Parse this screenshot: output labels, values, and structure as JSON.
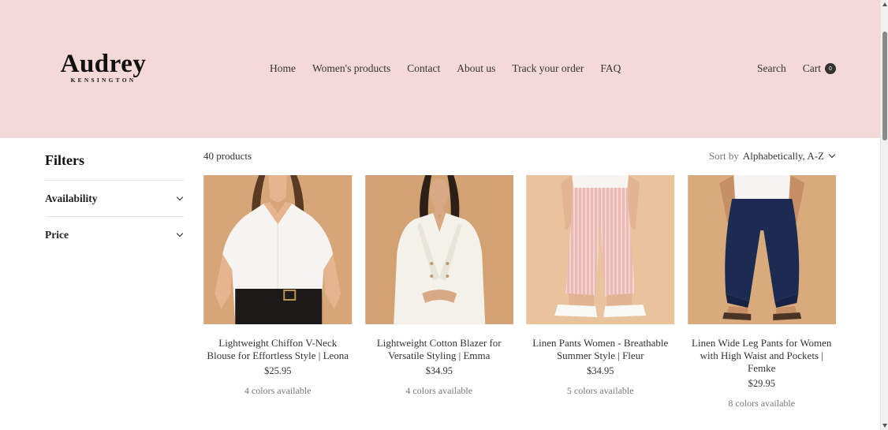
{
  "brand": {
    "name": "Audrey",
    "subtitle": "KENSINGTON"
  },
  "nav": [
    {
      "label": "Home"
    },
    {
      "label": "Women's products"
    },
    {
      "label": "Contact"
    },
    {
      "label": "About us"
    },
    {
      "label": "Track your order"
    },
    {
      "label": "FAQ"
    }
  ],
  "header": {
    "search_label": "Search",
    "cart_label": "Cart",
    "cart_count": "0"
  },
  "filters": {
    "title": "Filters",
    "items": [
      {
        "label": "Availability"
      },
      {
        "label": "Price"
      }
    ]
  },
  "toolbar": {
    "count": "40 products",
    "sort_label": "Sort by",
    "sort_value": "Alphabetically, A-Z"
  },
  "products": [
    {
      "name": "Lightweight Chiffon V-Neck Blouse for Effortless Style | Leona",
      "price": "$25.95",
      "colors": "4 colors available",
      "image": "woman-white-vneck-blouse-photo"
    },
    {
      "name": "Lightweight Cotton Blazer for Versatile Styling | Emma",
      "price": "$34.95",
      "colors": "4 colors available",
      "image": "woman-white-blazer-photo"
    },
    {
      "name": "Linen Pants Women - Breathable Summer Style | Fleur",
      "price": "$34.95",
      "colors": "5 colors available",
      "image": "pink-striped-linen-pants-photo"
    },
    {
      "name": "Linen Wide Leg Pants for Women with High Waist and Pockets | Femke",
      "price": "$29.95",
      "colors": "8 colors available",
      "image": "navy-wide-leg-pants-photo"
    }
  ],
  "colors": {
    "header_bg": "#f5d9d8",
    "photo_bg": "#d6a87a",
    "text": "#333333",
    "muted": "#777777"
  }
}
